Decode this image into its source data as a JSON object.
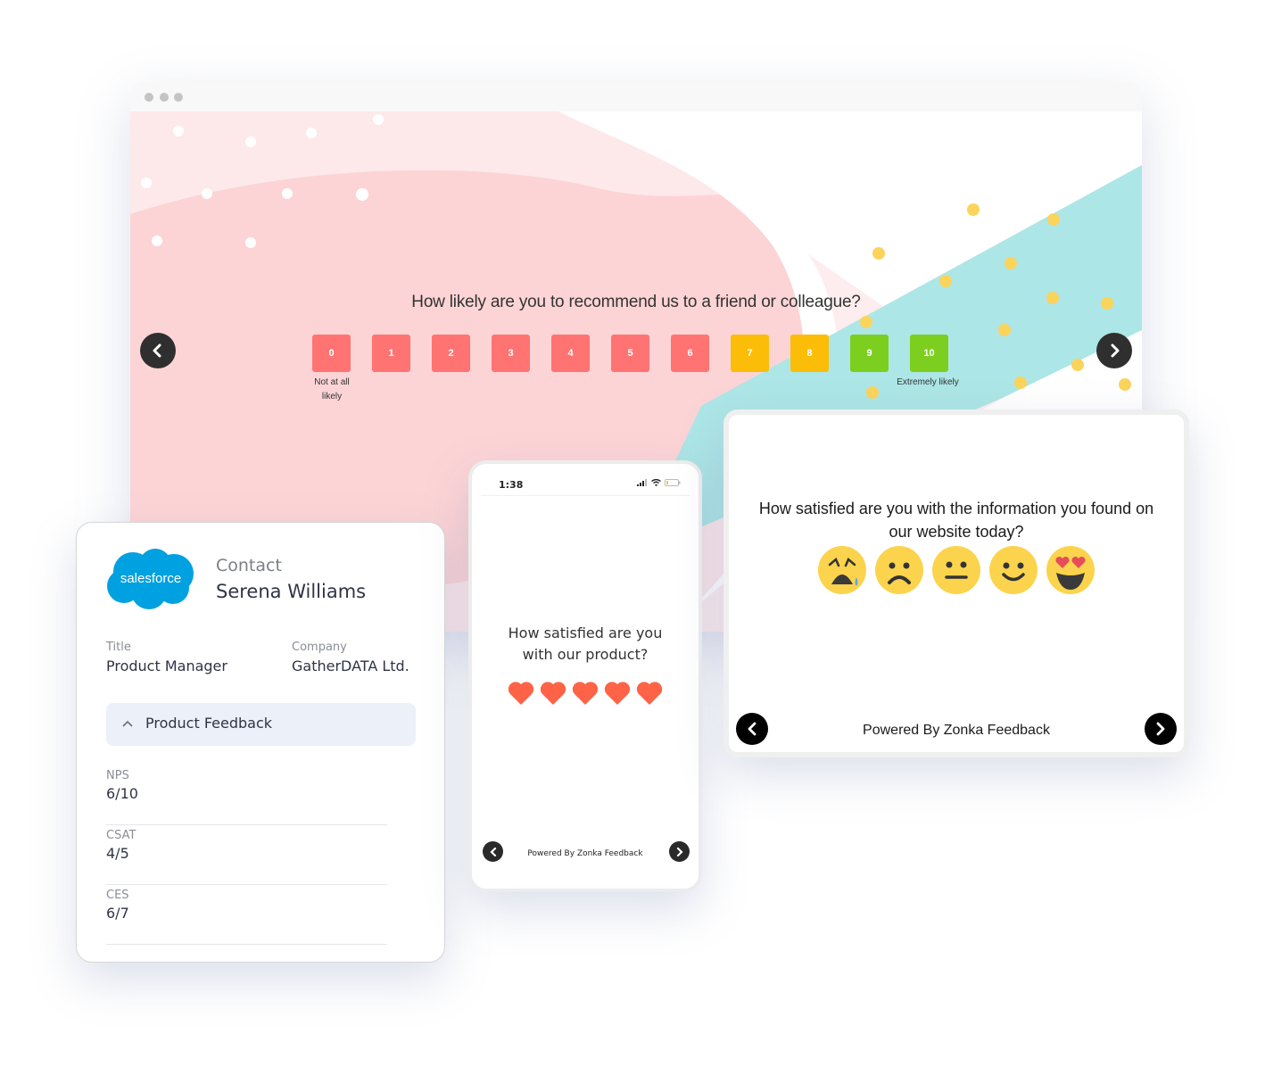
{
  "colors": {
    "detractor": "#ff7373",
    "passive": "#fbbd08",
    "promoter": "#7ccf1f",
    "heart": "#ff6347",
    "salesforce_blue": "#00a1e0",
    "teal_brush": "#ade6e6",
    "pink_bg": "#fcd4d6",
    "dots_yellow": "#fbd45c"
  },
  "browser": {
    "nps": {
      "question": "How likely are you to recommend us to a friend or colleague?",
      "options": [
        {
          "label": "0",
          "group": "detractor"
        },
        {
          "label": "1",
          "group": "detractor"
        },
        {
          "label": "2",
          "group": "detractor"
        },
        {
          "label": "3",
          "group": "detractor"
        },
        {
          "label": "4",
          "group": "detractor"
        },
        {
          "label": "5",
          "group": "detractor"
        },
        {
          "label": "6",
          "group": "detractor"
        },
        {
          "label": "7",
          "group": "passive"
        },
        {
          "label": "8",
          "group": "passive"
        },
        {
          "label": "9",
          "group": "promoter"
        },
        {
          "label": "10",
          "group": "promoter"
        }
      ],
      "low_label_line1": "Not at all",
      "low_label_line2": "likely",
      "high_label": "Extremely likely"
    },
    "prev_icon": "chevron-left-icon",
    "next_icon": "chevron-right-icon"
  },
  "crm": {
    "logo_text": "salesforce",
    "contact_label": "Contact",
    "contact_name": "Serena Williams",
    "title_label": "Title",
    "title_value": "Product Manager",
    "company_label": "Company",
    "company_value": "GatherDATA Ltd.",
    "section_title": "Product Feedback",
    "section_icon": "chevron-up-icon",
    "metrics": [
      {
        "label": "NPS",
        "value": "6/10"
      },
      {
        "label": "CSAT",
        "value": "4/5"
      },
      {
        "label": "CES",
        "value": "6/7"
      }
    ]
  },
  "phone": {
    "time": "1:38",
    "question_line1": "How satisfied are you",
    "question_line2": "with our product?",
    "hearts_count": 5,
    "footer": "Powered By Zonka Feedback"
  },
  "tablet": {
    "question_line1": "How satisfied are you with the information you found on",
    "question_line2": "our website today?",
    "emojis": [
      "crying-face",
      "frowning-face",
      "neutral-face",
      "slightly-smiling-face",
      "heart-eyes-face"
    ],
    "footer": "Powered By Zonka Feedback"
  }
}
